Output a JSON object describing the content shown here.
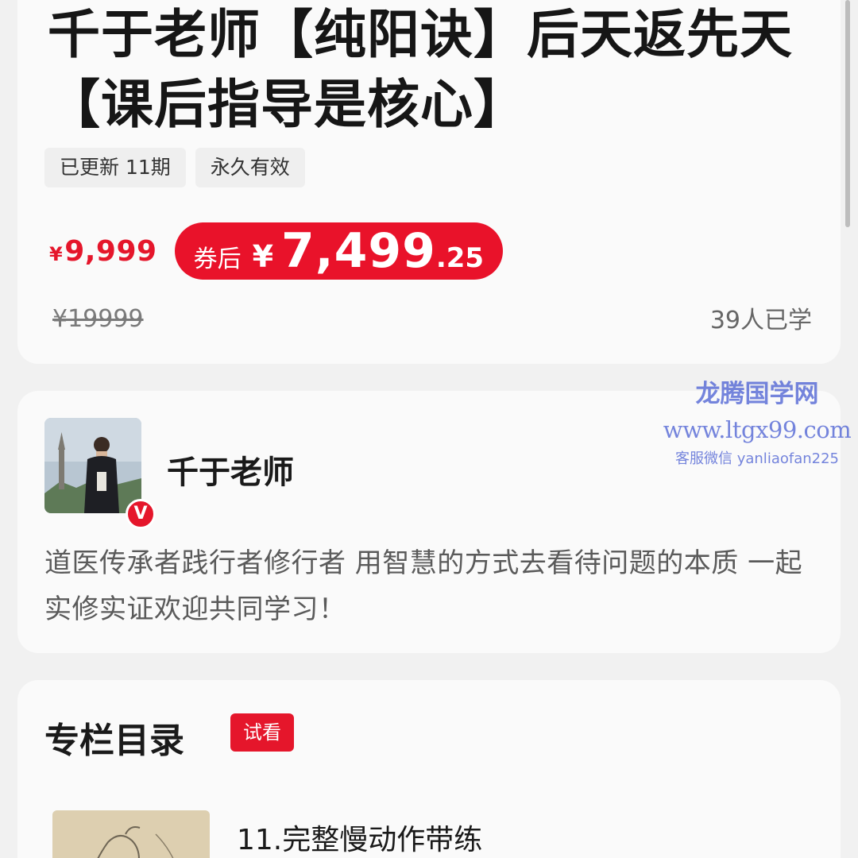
{
  "course": {
    "title": "千于老师【纯阳诀】后天返先天【课后指导是核心】",
    "tags": [
      "已更新 11期",
      "永久有效"
    ],
    "price_symbol": "¥",
    "price": "9,999",
    "coupon_label": "券后",
    "coupon_symbol": "¥",
    "coupon_int": "7,499",
    "coupon_dec": ".25",
    "original_price": "¥19999",
    "learners": "39人已学"
  },
  "teacher": {
    "name": "千于老师",
    "verified_mark": "V",
    "bio": "道医传承者践行者修行者 用智慧的方式去看待问题的本质 一起实修实证欢迎共同学习！"
  },
  "catalog": {
    "title": "专栏目录",
    "trial_label": "试看",
    "lessons": [
      {
        "title": "11.完整慢动作带练"
      }
    ]
  },
  "watermark": {
    "brand": "龙腾国学网",
    "url": "www.ltgx99.com",
    "contact": "客服微信 yanliaofan225"
  },
  "colors": {
    "accent_red": "#e5162b",
    "watermark_blue": "#4f63d4",
    "background": "#f1f1f1"
  }
}
